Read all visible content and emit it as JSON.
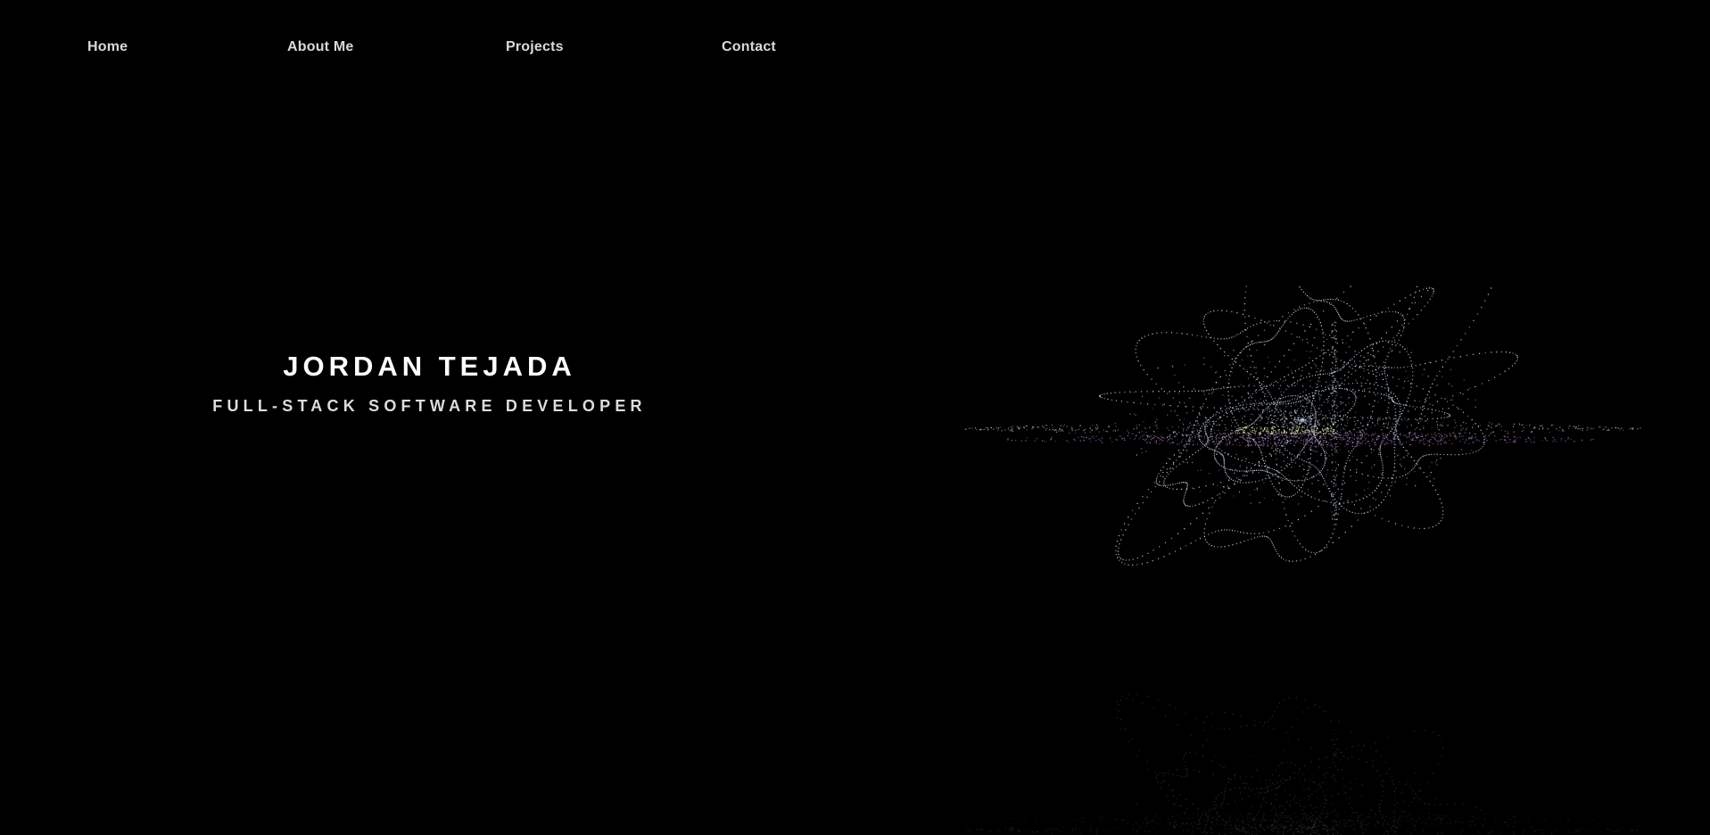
{
  "nav": {
    "items": [
      {
        "label": "Home"
      },
      {
        "label": "About Me"
      },
      {
        "label": "Projects"
      },
      {
        "label": "Contact"
      }
    ]
  },
  "hero": {
    "name": "JORDAN TEJADA",
    "role": "FULL-STACK SOFTWARE DEVELOPER"
  },
  "colors": {
    "background": "#000000",
    "nav_text": "#d9d9d9",
    "title": "#ffffff",
    "particle_main": "#c9d8ea",
    "particle_accent": "#a877c8",
    "particle_highlight": "#e9e69a"
  }
}
